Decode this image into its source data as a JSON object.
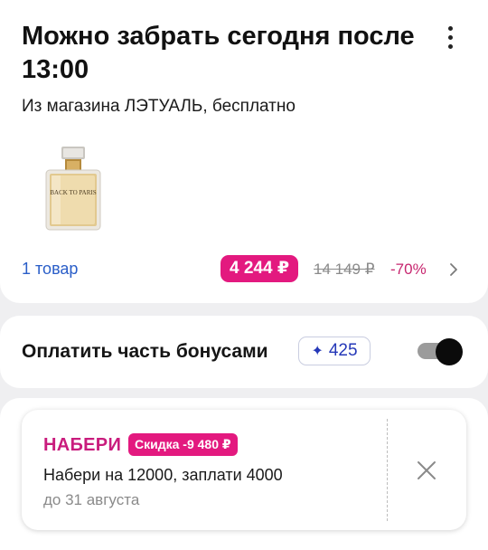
{
  "pickup": {
    "title": "Можно забрать сегодня после 13:00",
    "subtitle": "Из магазина ЛЭТУАЛЬ, бесплатно",
    "product_image_text": "BACK TO PARIS",
    "items_link": "1 товар",
    "price": "4 244 ₽",
    "old_price": "14 149 ₽",
    "discount": "-70%"
  },
  "bonus": {
    "label": "Оплатить часть бонусами",
    "amount": "425",
    "chip_icon": "sparkle-icon",
    "toggle_on": true
  },
  "promo": {
    "title": "НАБЕРИ",
    "badge": "Скидка -9 480 ₽",
    "description": "Набери на 12000, заплати 4000",
    "valid_until": "до 31 августа"
  },
  "colors": {
    "accent_pink": "#e3197f",
    "link_blue": "#2a5ec8",
    "bonus_blue": "#2538b8",
    "background": "#efeff1"
  }
}
